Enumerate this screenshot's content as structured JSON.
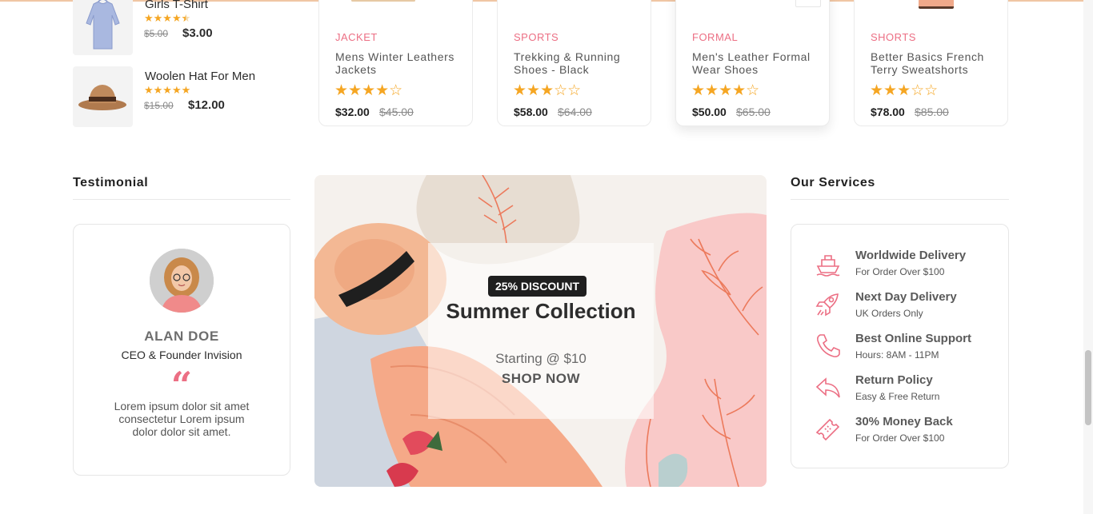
{
  "mini_products": [
    {
      "name": "Girls T-Shirt",
      "rating": 4.5,
      "old_price": "$5.00",
      "price": "$3.00",
      "thumb_icon": "sweater-thumbnail"
    },
    {
      "name": "Woolen Hat For Men",
      "rating": 5,
      "old_price": "$15.00",
      "price": "$12.00",
      "thumb_icon": "hat-thumbnail"
    }
  ],
  "product_cards": [
    {
      "category": "JACKET",
      "title": "Mens Winter Leathers Jackets",
      "stars": "★★★★☆",
      "price": "$32.00",
      "old_price": "$45.00"
    },
    {
      "category": "SPORTS",
      "title": "Trekking & Running Shoes - Black",
      "stars": "★★★☆☆",
      "price": "$58.00",
      "old_price": "$64.00"
    },
    {
      "category": "FORMAL",
      "title": "Men's Leather Formal Wear Shoes",
      "stars": "★★★★☆",
      "price": "$50.00",
      "old_price": "$65.00"
    },
    {
      "category": "SHORTS",
      "title": "Better Basics French Terry Sweatshorts",
      "stars": "★★★☆☆",
      "price": "$78.00",
      "old_price": "$85.00"
    }
  ],
  "testimonial": {
    "heading": "Testimonial",
    "name": "ALAN DOE",
    "role": "CEO & Founder Invision",
    "quote_mark": "“",
    "text": "Lorem ipsum dolor sit amet consectetur Lorem ipsum dolor dolor sit amet."
  },
  "banner": {
    "badge": "25% DISCOUNT",
    "title": "Summer Collection",
    "subtitle": "Starting @ $10",
    "cta": "SHOP NOW"
  },
  "services": {
    "heading": "Our Services",
    "items": [
      {
        "title": "Worldwide Delivery",
        "subtitle": "For Order Over $100",
        "icon": "ship-icon"
      },
      {
        "title": "Next Day Delivery",
        "subtitle": "UK Orders Only",
        "icon": "rocket-icon"
      },
      {
        "title": "Best Online Support",
        "subtitle": "Hours: 8AM - 11PM",
        "icon": "phone-icon"
      },
      {
        "title": "Return Policy",
        "subtitle": "Easy & Free Return",
        "icon": "return-arrow-icon"
      },
      {
        "title": "30% Money Back",
        "subtitle": "For Order Over $100",
        "icon": "ticket-icon"
      }
    ]
  },
  "colors": {
    "accent": "#ec6f84",
    "star": "#f5a623",
    "text": "#212121"
  }
}
